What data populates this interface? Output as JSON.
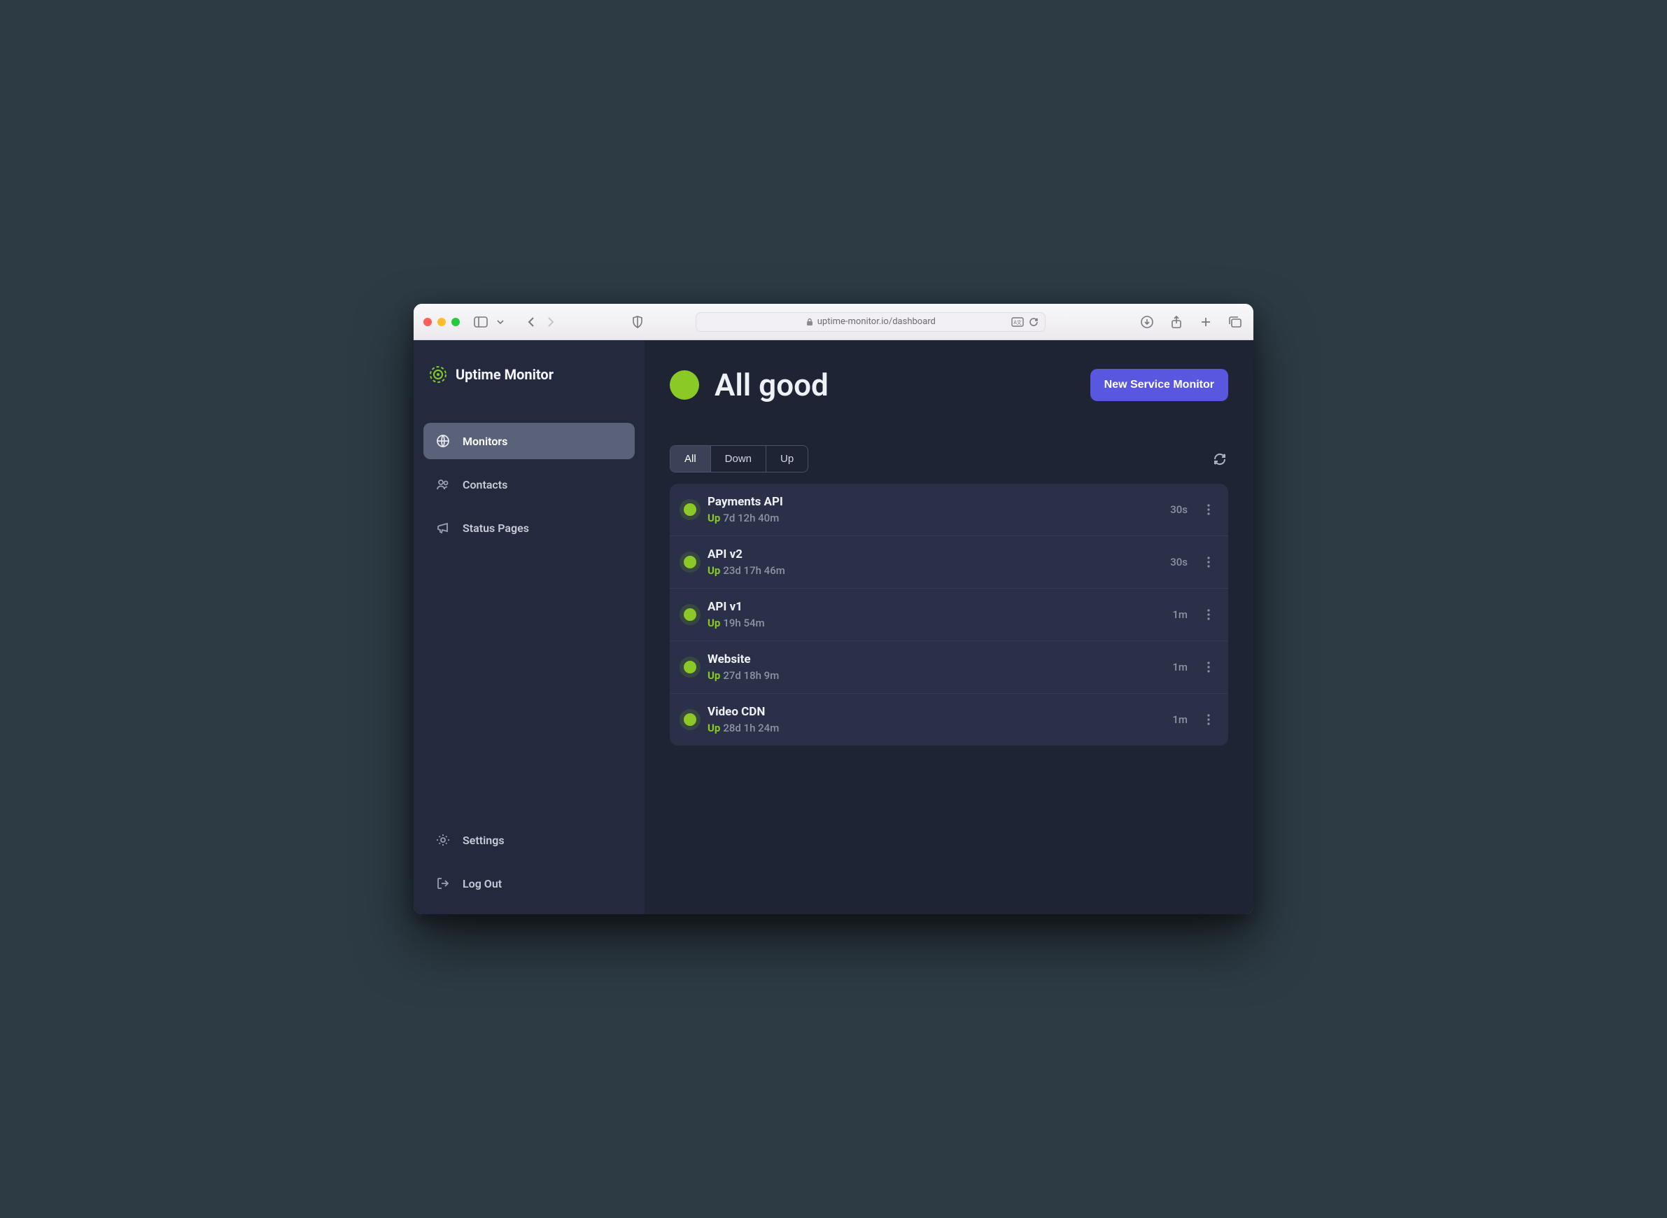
{
  "browser": {
    "url": "uptime-monitor.io/dashboard"
  },
  "brand": {
    "name": "Uptime Monitor"
  },
  "sidebar": {
    "items": [
      {
        "label": "Monitors",
        "active": true
      },
      {
        "label": "Contacts",
        "active": false
      },
      {
        "label": "Status Pages",
        "active": false
      }
    ],
    "footer": [
      {
        "label": "Settings"
      },
      {
        "label": "Log Out"
      }
    ]
  },
  "header": {
    "status_text": "All good",
    "primary_button": "New Service Monitor"
  },
  "filters": {
    "tabs": [
      {
        "label": "All",
        "active": true
      },
      {
        "label": "Down",
        "active": false
      },
      {
        "label": "Up",
        "active": false
      }
    ]
  },
  "monitors": [
    {
      "name": "Payments API",
      "status_label": "Up",
      "uptime": "7d 12h 40m",
      "interval": "30s"
    },
    {
      "name": "API v2",
      "status_label": "Up",
      "uptime": "23d 17h 46m",
      "interval": "30s"
    },
    {
      "name": "API v1",
      "status_label": "Up",
      "uptime": "19h 54m",
      "interval": "1m"
    },
    {
      "name": "Website",
      "status_label": "Up",
      "uptime": "27d 18h 9m",
      "interval": "1m"
    },
    {
      "name": "Video CDN",
      "status_label": "Up",
      "uptime": "28d 1h 24m",
      "interval": "1m"
    }
  ]
}
